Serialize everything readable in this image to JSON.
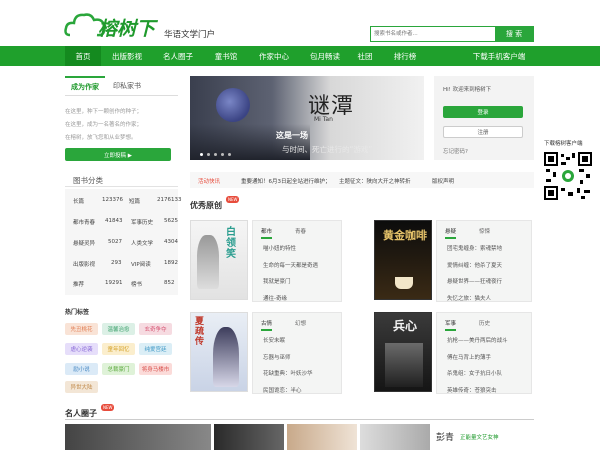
{
  "header": {
    "logo_text": "榕树下",
    "slogan": "华语文学门户",
    "search_placeholder": "搜索书名或作者...",
    "search_button": "搜 索"
  },
  "nav": {
    "items": [
      "首页",
      "出版影视",
      "名人圈子",
      "童书馆",
      "作家中心",
      "包月畅读",
      "社团",
      "排行榜"
    ],
    "download": "下载手机客户端"
  },
  "left": {
    "tab_active": "成为作家",
    "tab_other": "印私家书",
    "lines": [
      "在这里，种下一颗创作的种子；",
      "在这里，成为一名著名的作家；",
      "在榕树，放飞您和从业梦想。"
    ],
    "cta": "立即投稿 ▶",
    "cat_title": "图书分类",
    "cats": [
      [
        "长篇",
        "123376",
        "短篇",
        "2176133"
      ],
      [
        "都市青春",
        "41843",
        "军事历史",
        "5625"
      ],
      [
        "悬疑灵异",
        "5027",
        "人类文学",
        "4304"
      ],
      [
        "出版影视",
        "293",
        "VIP阅读",
        "1892"
      ],
      [
        "推荐",
        "19291",
        "榜书",
        "852"
      ]
    ],
    "hot_title": "热门标签",
    "tags": [
      "先丑桃花",
      "温馨治愈",
      "玄奇争夺",
      "虐心逆袭",
      "童年回忆",
      "纯爱宫廷",
      "励小说",
      "总裁豪门",
      "将身马楼市",
      "异世大陆"
    ]
  },
  "banner": {
    "title": "谜潭",
    "subtitle": "Mi Tan",
    "line1": "这是一场",
    "line2": "与时间、死亡进行的“游戏”"
  },
  "login": {
    "greet": "Hi! 欢迎来到榕树下",
    "login": "登录",
    "register": "注册",
    "forgot": "忘记密码?"
  },
  "qr": {
    "label": "下载榕树客户端"
  },
  "ticker": {
    "label": "活动快讯",
    "items": [
      "重要通知！6月3日起全站进行维护；",
      "主题征文：陕向大开之神转折",
      "版权声明"
    ]
  },
  "section1": {
    "title": "优秀原创",
    "badge": "NEW"
  },
  "panels": [
    {
      "tab_a": "都市",
      "tab_b": "青春",
      "cover": "白领笑",
      "items": [
        "喵小妞的特性",
        "生命的每一天都是奇遇",
        "我就是豪门",
        "通往-奇缘"
      ]
    },
    {
      "tab_a": "悬疑",
      "tab_b": "惊悚",
      "cover": "黄金咖啡",
      "items": [
        "团宅鬼缠身：索魂禁地",
        "爱情纠缠：他杀了夏天",
        "悬疑世界——狂魂夜行",
        "失忆之旅：猫夫人"
      ]
    },
    {
      "tab_a": "古情",
      "tab_b": "幻想",
      "cover": "夏疏传",
      "items": [
        "长安未眠",
        "忘器与巫师",
        "花缺重典：叶妖沙华",
        "民国诡恋：半心"
      ]
    },
    {
      "tab_a": "军事",
      "tab_b": "历史",
      "cover": "兵心",
      "items": [
        "抗枪——美丹两后的战斗",
        "傅在马背上的薄手",
        "杀鬼组：女子抗日小队",
        "英雄传奇：苍狼突击"
      ]
    }
  ],
  "section2": {
    "title": "名人圈子",
    "badge": "NEW",
    "person": "彭青",
    "person_desc": "正能量文艺女神"
  },
  "colors": {
    "brand": "#2aa63b",
    "nav": "#1fa02c",
    "accent": "#e74c3c"
  }
}
